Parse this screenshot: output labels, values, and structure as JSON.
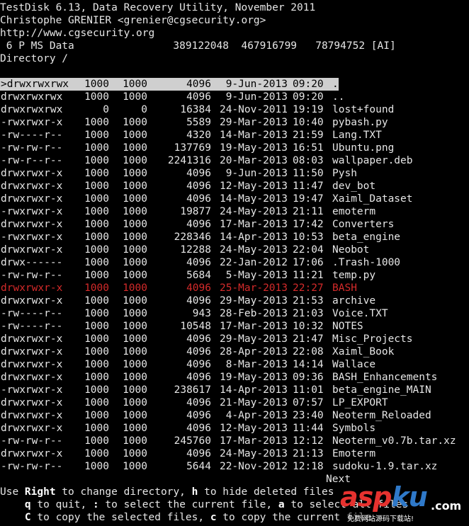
{
  "header": {
    "title": "TestDisk 6.13, Data Recovery Utility, November 2011",
    "author": "Christophe GRENIER <grenier@cgsecurity.org>",
    "url": "http://www.cgsecurity.org",
    "partition": " 6 P MS Data                389122048  467916799   78794752 [AI]",
    "directory": "Directory /"
  },
  "colors": {
    "selected_bg": "#cfcfcf",
    "deleted": "#d42a2a",
    "text": "#e6e6e6",
    "background": "#000000"
  },
  "files": [
    {
      "perm": ">drwxrwxrwx",
      "uid": "1000",
      "gid": "1000",
      "size": "4096",
      "date": "9-Jun-2013",
      "time": "09:20",
      "name": ".",
      "selected": true
    },
    {
      "perm": "drwxrwxrwx",
      "uid": "1000",
      "gid": "1000",
      "size": "4096",
      "date": "9-Jun-2013",
      "time": "09:20",
      "name": ".."
    },
    {
      "perm": "drwxrwxrwx",
      "uid": "0",
      "gid": "0",
      "size": "16384",
      "date": "24-Nov-2011",
      "time": "19:19",
      "name": "lost+found"
    },
    {
      "perm": "-rwxrwxr-x",
      "uid": "1000",
      "gid": "1000",
      "size": "5589",
      "date": "29-Mar-2013",
      "time": "10:40",
      "name": "pybash.py"
    },
    {
      "perm": "-rw----r--",
      "uid": "1000",
      "gid": "1000",
      "size": "4320",
      "date": "14-Mar-2013",
      "time": "21:59",
      "name": "Lang.TXT"
    },
    {
      "perm": "-rw-rw-r--",
      "uid": "1000",
      "gid": "1000",
      "size": "137769",
      "date": "19-May-2013",
      "time": "16:51",
      "name": "Ubuntu.png"
    },
    {
      "perm": "-rw-r--r--",
      "uid": "1000",
      "gid": "1000",
      "size": "2241316",
      "date": "20-Mar-2013",
      "time": "08:03",
      "name": "wallpaper.deb"
    },
    {
      "perm": "drwxrwxr-x",
      "uid": "1000",
      "gid": "1000",
      "size": "4096",
      "date": "9-Jun-2013",
      "time": "11:50",
      "name": "Pysh"
    },
    {
      "perm": "drwxrwxr-x",
      "uid": "1000",
      "gid": "1000",
      "size": "4096",
      "date": "12-May-2013",
      "time": "11:47",
      "name": "dev_bot"
    },
    {
      "perm": "drwxrwxr-x",
      "uid": "1000",
      "gid": "1000",
      "size": "4096",
      "date": "14-May-2013",
      "time": "19:47",
      "name": "Xaiml_Dataset"
    },
    {
      "perm": "-rwxrwxr-x",
      "uid": "1000",
      "gid": "1000",
      "size": "19877",
      "date": "24-May-2013",
      "time": "21:11",
      "name": "emoterm"
    },
    {
      "perm": "drwxrwxr-x",
      "uid": "1000",
      "gid": "1000",
      "size": "4096",
      "date": "17-Mar-2013",
      "time": "17:42",
      "name": "Converters"
    },
    {
      "perm": "-rwxrwxr-x",
      "uid": "1000",
      "gid": "1000",
      "size": "228346",
      "date": "14-Apr-2013",
      "time": "10:53",
      "name": "beta_engine"
    },
    {
      "perm": "drwxrwxr-x",
      "uid": "1000",
      "gid": "1000",
      "size": "12288",
      "date": "24-May-2013",
      "time": "22:04",
      "name": "Neobot"
    },
    {
      "perm": "drwx------",
      "uid": "1000",
      "gid": "1000",
      "size": "4096",
      "date": "22-Jan-2012",
      "time": "17:06",
      "name": ".Trash-1000"
    },
    {
      "perm": "-rw-rw-r--",
      "uid": "1000",
      "gid": "1000",
      "size": "5684",
      "date": "5-May-2013",
      "time": "11:21",
      "name": "temp.py"
    },
    {
      "perm": "drwxrwxr-x",
      "uid": "1000",
      "gid": "1000",
      "size": "4096",
      "date": "25-Mar-2013",
      "time": "22:27",
      "name": "BASH",
      "deleted": true
    },
    {
      "perm": "drwxrwxr-x",
      "uid": "1000",
      "gid": "1000",
      "size": "4096",
      "date": "29-May-2013",
      "time": "21:53",
      "name": "archive"
    },
    {
      "perm": "-rw----r--",
      "uid": "1000",
      "gid": "1000",
      "size": "943",
      "date": "28-Feb-2013",
      "time": "21:03",
      "name": "Voice.TXT"
    },
    {
      "perm": "-rw----r--",
      "uid": "1000",
      "gid": "1000",
      "size": "10548",
      "date": "17-Mar-2013",
      "time": "10:32",
      "name": "NOTES"
    },
    {
      "perm": "drwxrwxr-x",
      "uid": "1000",
      "gid": "1000",
      "size": "4096",
      "date": "29-May-2013",
      "time": "21:47",
      "name": "Misc_Projects"
    },
    {
      "perm": "drwxrwxr-x",
      "uid": "1000",
      "gid": "1000",
      "size": "4096",
      "date": "28-Apr-2013",
      "time": "22:08",
      "name": "Xaiml_Book"
    },
    {
      "perm": "drwxrwxr-x",
      "uid": "1000",
      "gid": "1000",
      "size": "4096",
      "date": "8-Mar-2013",
      "time": "14:14",
      "name": "Wallace"
    },
    {
      "perm": "drwxrwxr-x",
      "uid": "1000",
      "gid": "1000",
      "size": "4096",
      "date": "19-May-2013",
      "time": "09:36",
      "name": "BASH_Enhancements"
    },
    {
      "perm": "-rwxrwxr-x",
      "uid": "1000",
      "gid": "1000",
      "size": "238617",
      "date": "14-Apr-2013",
      "time": "11:01",
      "name": "beta_engine_MAIN"
    },
    {
      "perm": "drwxrwxr-x",
      "uid": "1000",
      "gid": "1000",
      "size": "4096",
      "date": "21-May-2013",
      "time": "07:57",
      "name": "LP_EXPORT"
    },
    {
      "perm": "drwxrwxr-x",
      "uid": "1000",
      "gid": "1000",
      "size": "4096",
      "date": "4-Apr-2013",
      "time": "23:40",
      "name": "Neoterm_Reloaded"
    },
    {
      "perm": "drwxrwxr-x",
      "uid": "1000",
      "gid": "1000",
      "size": "4096",
      "date": "12-May-2013",
      "time": "11:44",
      "name": "Symbols"
    },
    {
      "perm": "-rw-rw-r--",
      "uid": "1000",
      "gid": "1000",
      "size": "245760",
      "date": "17-Mar-2013",
      "time": "12:12",
      "name": "Neoterm_v0.7b.tar.xz"
    },
    {
      "perm": "drwxrwxr-x",
      "uid": "1000",
      "gid": "1000",
      "size": "4096",
      "date": "24-May-2013",
      "time": "21:13",
      "name": "Emoterm"
    },
    {
      "perm": "-rw-rw-r--",
      "uid": "1000",
      "gid": "1000",
      "size": "5644",
      "date": "22-Nov-2012",
      "time": "12:18",
      "name": "sudoku-1.9.tar.xz"
    }
  ],
  "next_label": "Next",
  "help": {
    "line1": {
      "pre": "Use ",
      "key1": "Right",
      "mid1": " to change directory, ",
      "key2": "h",
      "post": " to hide deleted files"
    },
    "line2": {
      "pre": "    ",
      "key1": "q",
      "mid1": " to quit, ",
      "key2": ":",
      "mid2": " to select the current file, ",
      "key3": "a",
      "post": " to select all files"
    },
    "line3": {
      "pre": "    ",
      "key1": "C",
      "mid1": " to copy the selected files, ",
      "key2": "c",
      "post": " to copy the current file"
    }
  },
  "watermark": {
    "logo": "aspku",
    "dot_com": ".com",
    "subtitle": "免费网站源码下载站!"
  }
}
